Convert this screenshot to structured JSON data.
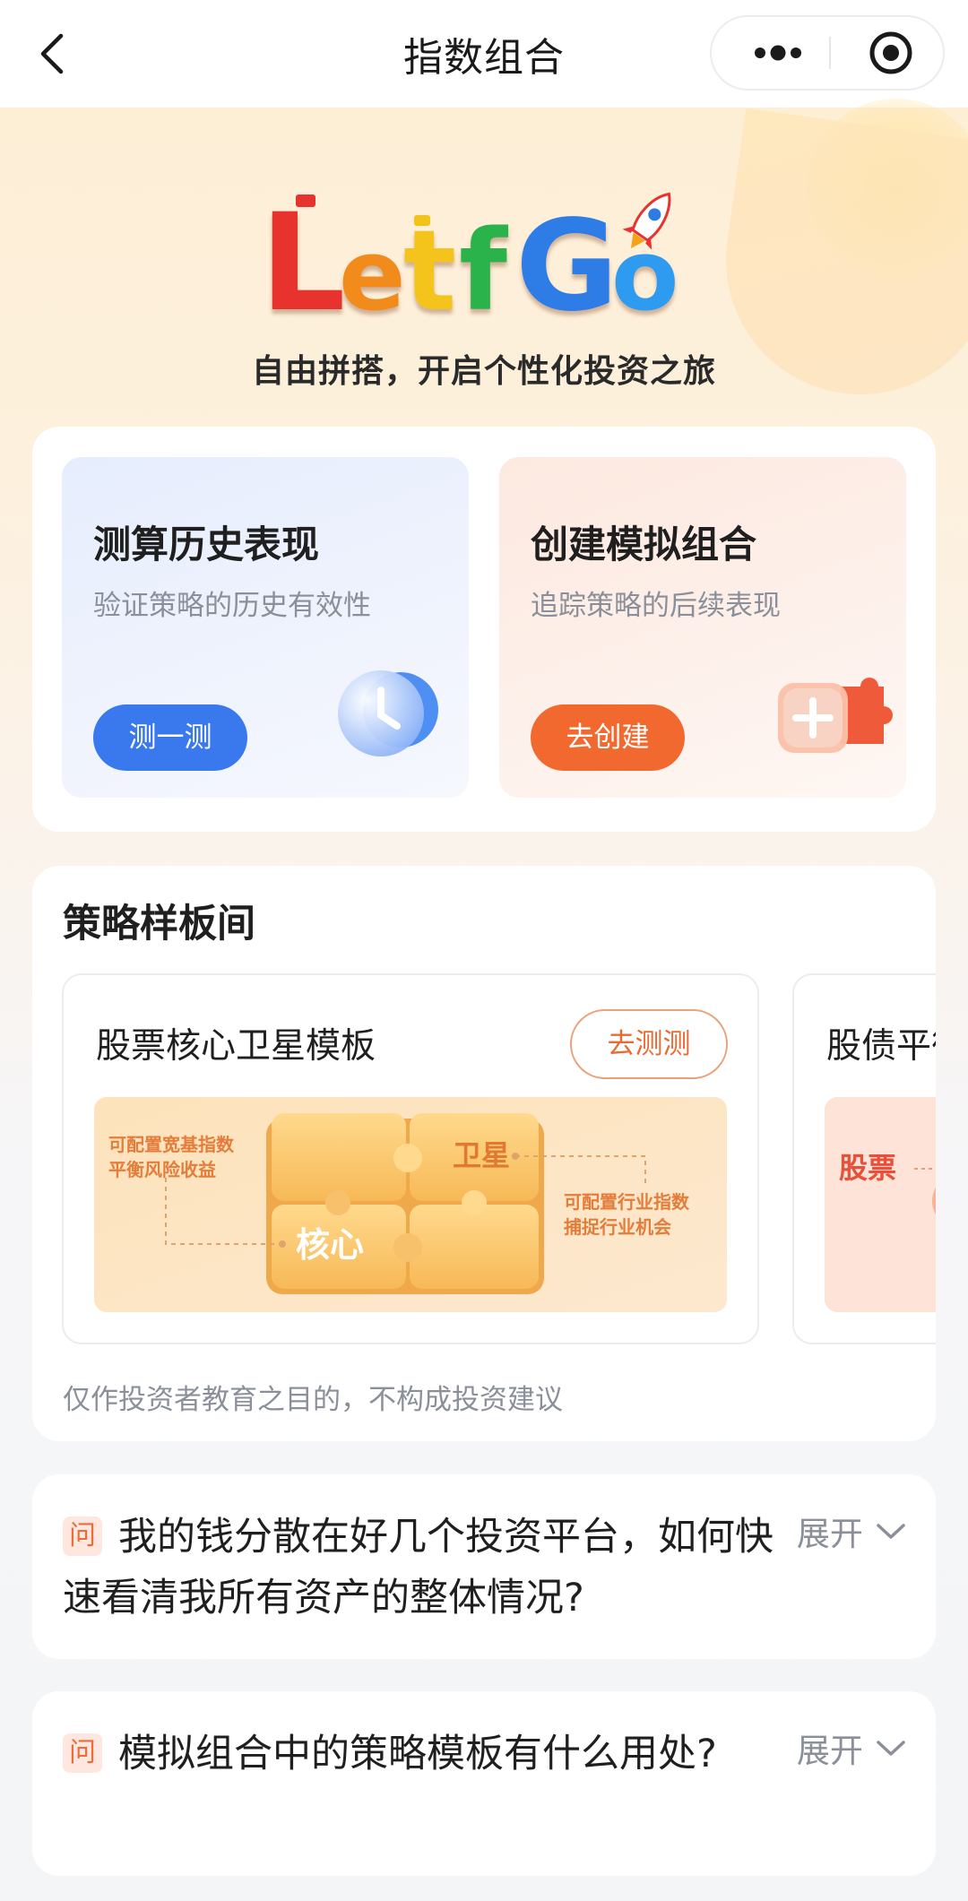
{
  "nav": {
    "title": "指数组合"
  },
  "hero": {
    "logo_text": "LetfGo",
    "slogan": "自由拼搭，开启个性化投资之旅"
  },
  "features": [
    {
      "title": "测算历史表现",
      "subtitle": "验证策略的历史有效性",
      "button": "测一测",
      "icon": "clock-icon"
    },
    {
      "title": "创建模拟组合",
      "subtitle": "追踪策略的后续表现",
      "button": "去创建",
      "icon": "puzzle-plus-icon"
    }
  ],
  "strategy": {
    "title": "策略样板间",
    "templates": [
      {
        "title": "股票核心卫星模板",
        "button": "去测测",
        "art": {
          "core": "核心",
          "satellite": "卫星",
          "left_note_1": "可配置宽基指数",
          "left_note_2": "平衡风险收益",
          "right_note_1": "可配置行业指数",
          "right_note_2": "捕捉行业机会"
        }
      },
      {
        "title": "股债平衡",
        "art": {
          "label": "股票"
        }
      }
    ],
    "disclaimer": "仅作投资者教育之目的，不构成投资建议"
  },
  "faq": [
    {
      "badge": "问",
      "question": "我的钱分散在好几个投资平台，如何快速看清我所有资产的整体情况?",
      "expand": "展开"
    },
    {
      "badge": "问",
      "question": "模拟组合中的策略模板有什么用处?",
      "expand": "展开"
    }
  ]
}
